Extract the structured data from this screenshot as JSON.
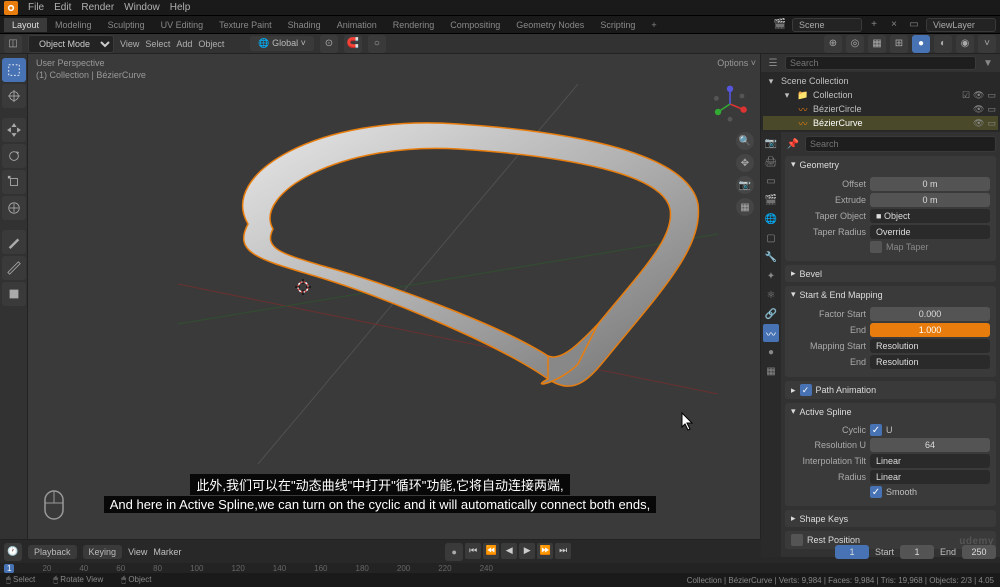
{
  "menubar": {
    "items": [
      "File",
      "Edit",
      "Render",
      "Window",
      "Help"
    ]
  },
  "workspaces": {
    "tabs": [
      "Layout",
      "Modeling",
      "Sculpting",
      "UV Editing",
      "Texture Paint",
      "Shading",
      "Animation",
      "Rendering",
      "Compositing",
      "Geometry Nodes",
      "Scripting"
    ],
    "active": 0
  },
  "scene": {
    "name": "Scene",
    "layer": "ViewLayer"
  },
  "mode": {
    "current": "Object Mode"
  },
  "sec_menu": [
    "View",
    "Select",
    "Add",
    "Object"
  ],
  "orientation": {
    "value": "Global"
  },
  "viewport": {
    "header_line1": "User Perspective",
    "header_line2": "(1) Collection | BézierCurve",
    "options": "Options"
  },
  "outliner": {
    "root": "Scene Collection",
    "items": [
      {
        "name": "Collection",
        "indent": 12
      },
      {
        "name": "BézierCircle",
        "indent": 24,
        "icon": "curve"
      },
      {
        "name": "BézierCurve",
        "indent": 24,
        "icon": "curve",
        "selected": true
      }
    ],
    "search_placeholder": "Search"
  },
  "props_search": "Search",
  "geometry": {
    "title": "Geometry",
    "offset_label": "Offset",
    "offset": "0 m",
    "extrude_label": "Extrude",
    "extrude": "0 m",
    "taper_obj_label": "Taper Object",
    "taper_obj": "Object",
    "taper_radius_label": "Taper Radius",
    "taper_radius": "Override",
    "map_taper": "Map Taper"
  },
  "bevel": {
    "title": "Bevel"
  },
  "start_end": {
    "title": "Start & End Mapping",
    "factor_start_label": "Factor Start",
    "factor_start": "0.000",
    "end_label": "End",
    "end": "1.000",
    "mapping_start_label": "Mapping Start",
    "mapping_start": "Resolution",
    "mapping_end_label": "End",
    "mapping_end": "Resolution"
  },
  "path_anim": {
    "title": "Path Animation",
    "checked": true
  },
  "active_spline": {
    "title": "Active Spline",
    "cyclic_label": "Cyclic",
    "cyclic_u": "U",
    "resolution_label": "Resolution U",
    "resolution": "64",
    "interp_tilt_label": "Interpolation Tilt",
    "interp_tilt": "Linear",
    "radius_label": "Radius",
    "radius": "Linear",
    "smooth_label": "Smooth"
  },
  "shape_keys": {
    "title": "Shape Keys"
  },
  "rest_pos": {
    "title": "Rest Position"
  },
  "timeline": {
    "playback": "Playback",
    "keying": "Keying",
    "view": "View",
    "marker": "Marker",
    "current": "1",
    "start_label": "Start",
    "start": "1",
    "end_label": "End",
    "end": "250",
    "ticks": [
      "20",
      "40",
      "60",
      "80",
      "100",
      "120",
      "140",
      "160",
      "180",
      "200",
      "220",
      "240"
    ]
  },
  "status": {
    "select": "Select",
    "rotate": "Rotate View",
    "object": "Object",
    "right": "Collection | BézierCurve   |   Verts: 9,984   |   Faces: 9,984   |   Tris: 19,968   |   Objects: 2/3 | 4.05"
  },
  "subtitles": {
    "cn": "此外,我们可以在\"动态曲线\"中打开\"循环\"功能,它将自动连接两端,",
    "en": "And here in Active Spline,we can turn on the cyclic and it will automatically connect both ends,"
  },
  "watermark": "udemy"
}
